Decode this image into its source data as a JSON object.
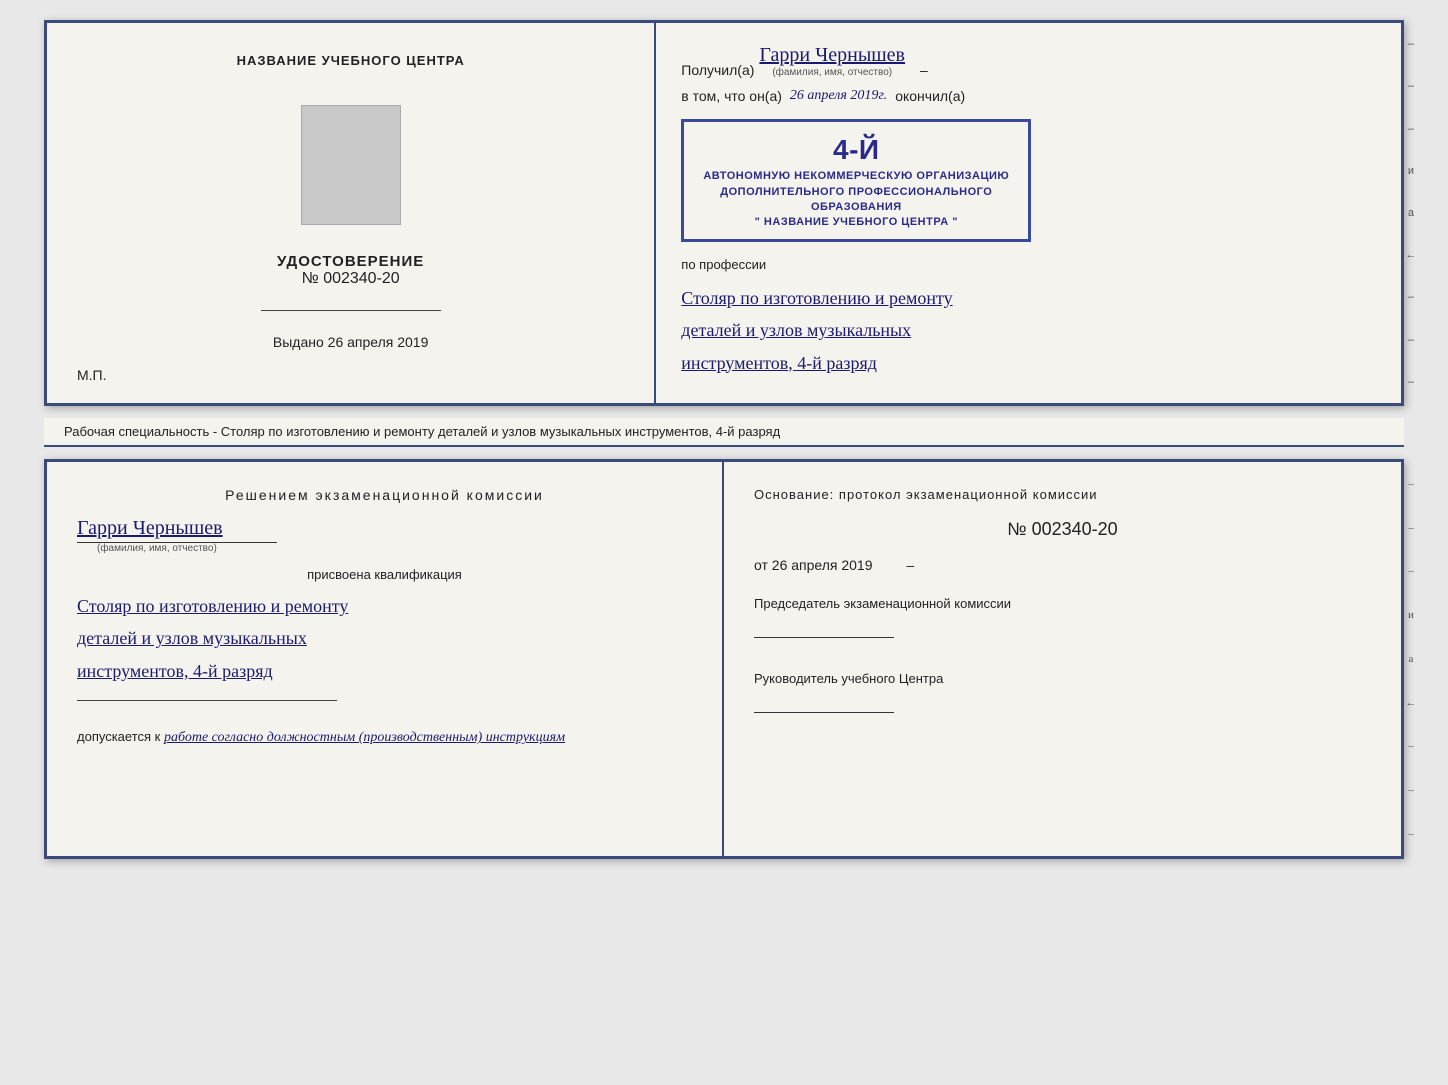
{
  "top_left": {
    "org_name": "НАЗВАНИЕ УЧЕБНОГО ЦЕНТРА",
    "cert_title": "УДОСТОВЕРЕНИЕ",
    "cert_number": "№ 002340-20",
    "issued_label": "Выдано",
    "issued_date": "26 апреля 2019",
    "mp_label": "М.П."
  },
  "top_right": {
    "received_label": "Получил(а)",
    "person_name": "Гарри Чернышев",
    "name_sublabel": "(фамилия, имя, отчество)",
    "date_prefix": "в том, что он(а)",
    "date_value": "26 апреля 2019г.",
    "finished_label": "окончил(а)",
    "stamp_line1": "4-й",
    "stamp_line2": "АВТОНОМНУЮ НЕКОММЕРЧЕСКУЮ ОРГАНИЗАЦИЮ",
    "stamp_line3": "ДОПОЛНИТЕЛЬНОГО ПРОФЕССИОНАЛЬНОГО ОБРАЗОВАНИЯ",
    "stamp_line4": "\" НАЗВАНИЕ УЧЕБНОГО ЦЕНТРА \"",
    "profession_prefix": "по профессии",
    "profession_line1": "Столяр по изготовлению и ремонту",
    "profession_line2": "деталей и узлов музыкальных",
    "profession_line3": "инструментов, 4-й разряд"
  },
  "description": "Рабочая специальность - Столяр по изготовлению и ремонту деталей и узлов музыкальных инструментов, 4-й разряд",
  "bottom_left": {
    "decision_title": "Решением  экзаменационной  комиссии",
    "person_name": "Гарри Чернышев",
    "name_sublabel": "(фамилия, имя, отчество)",
    "qualification_label": "присвоена квалификация",
    "qualification_line1": "Столяр по изготовлению и ремонту",
    "qualification_line2": "деталей и узлов музыкальных",
    "qualification_line3": "инструментов, 4-й разряд",
    "allowed_prefix": "допускается к",
    "allowed_text": "работе согласно должностным (производственным) инструкциям"
  },
  "bottom_right": {
    "basis_title": "Основание:  протокол  экзаменационной  комиссии",
    "protocol_number": "№  002340-20",
    "date_prefix": "от",
    "date_value": "26 апреля 2019",
    "chairman_title": "Председатель экзаменационной комиссии",
    "director_title": "Руководитель учебного Центра"
  },
  "side_chars": [
    "–",
    "–",
    "–",
    "и",
    "а",
    "←",
    "–",
    "–",
    "–"
  ]
}
